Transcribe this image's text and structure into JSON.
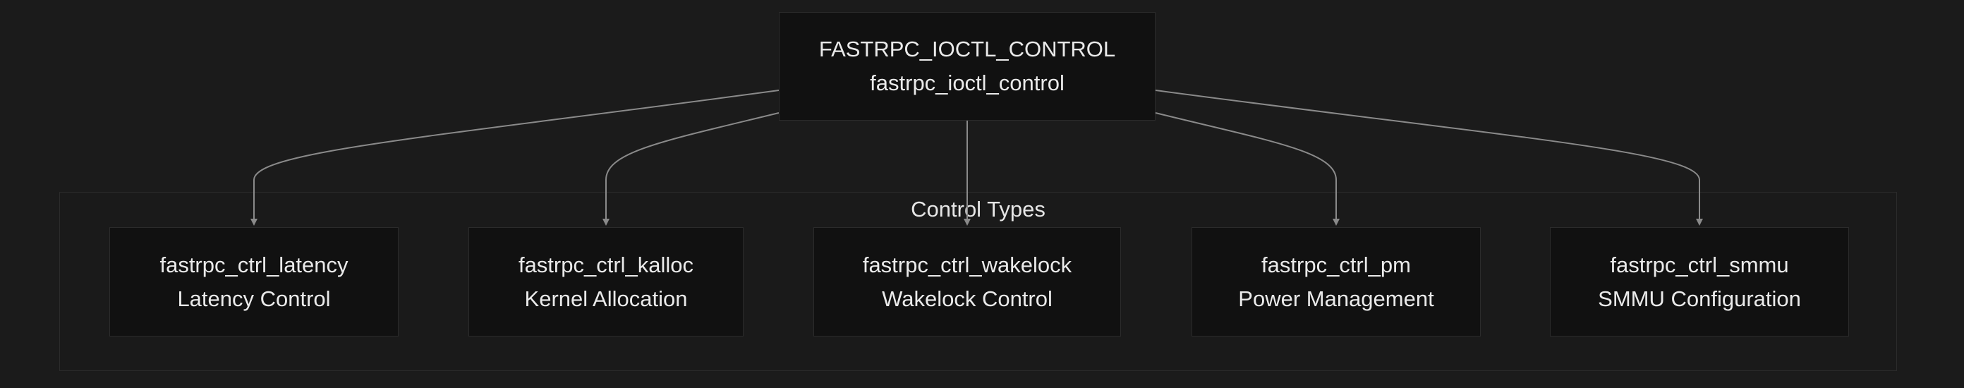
{
  "diagram": {
    "root": {
      "line1": "FASTRPC_IOCTL_CONTROL",
      "line2": "fastrpc_ioctl_control"
    },
    "cluster": {
      "label": "Control Types"
    },
    "children": [
      {
        "line1": "fastrpc_ctrl_latency",
        "line2": "Latency Control"
      },
      {
        "line1": "fastrpc_ctrl_kalloc",
        "line2": "Kernel Allocation"
      },
      {
        "line1": "fastrpc_ctrl_wakelock",
        "line2": "Wakelock Control"
      },
      {
        "line1": "fastrpc_ctrl_pm",
        "line2": "Power Management"
      },
      {
        "line1": "fastrpc_ctrl_smmu",
        "line2": "SMMU Configuration"
      }
    ],
    "colors": {
      "background": "#1b1b1b",
      "node_fill": "#111111",
      "node_border": "#2b2b2b",
      "edge": "#8a8a8a",
      "text": "#eaeaea"
    }
  }
}
